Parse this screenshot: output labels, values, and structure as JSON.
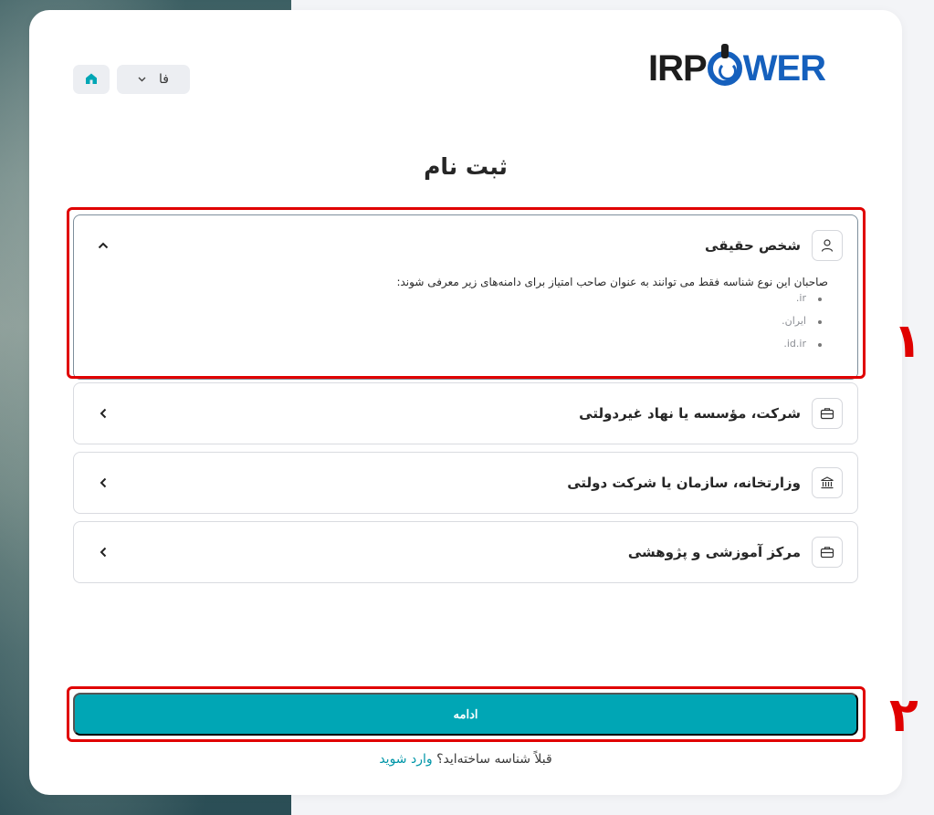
{
  "header": {
    "language": "فا",
    "logo": {
      "part1": "IRP",
      "part2": "WER"
    }
  },
  "page_title": "ثبت نام",
  "accordion": [
    {
      "label": "شخص حقیقی",
      "icon": "user-icon",
      "expanded": true,
      "description": "صاحبان این نوع شناسه فقط می توانند به عنوان صاحب امتیاز برای دامنه‌های زیر معرفی شوند:",
      "domains": [
        ".ir",
        ".ایران",
        ".id.ir"
      ]
    },
    {
      "label": "شرکت، مؤسسه یا نهاد غیردولتی",
      "icon": "briefcase-icon",
      "expanded": false
    },
    {
      "label": "وزارتخانه، سازمان یا شرکت دولتی",
      "icon": "bank-icon",
      "expanded": false
    },
    {
      "label": "مرکز آموزشی و پژوهشی",
      "icon": "briefcase-icon",
      "expanded": false
    }
  ],
  "annotations": {
    "box1_number": "۱",
    "box2_number": "۲"
  },
  "continue_label": "ادامه",
  "login": {
    "question": "قبلاً شناسه ساخته‌اید؟",
    "link": "وارد شوید"
  },
  "colors": {
    "accent": "#00a6b5",
    "annotation": "#e00000",
    "brand_blue": "#1560bd"
  }
}
